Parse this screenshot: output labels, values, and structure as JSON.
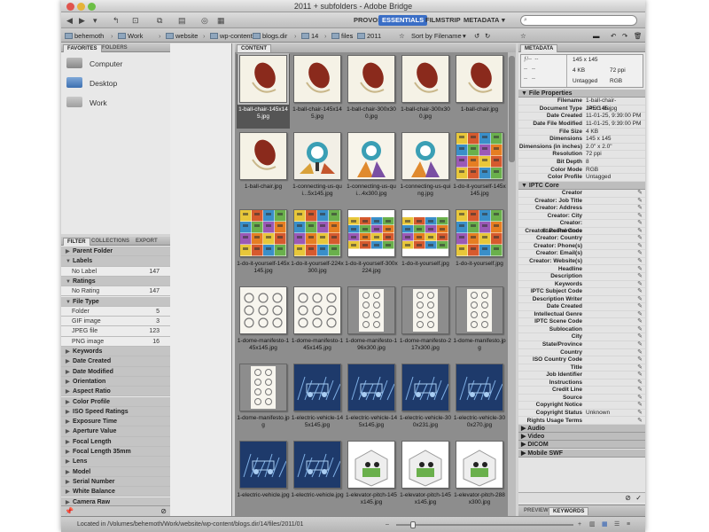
{
  "window": {
    "title": "2011 + subfolders - Adobe Bridge"
  },
  "workspaces": [
    {
      "label": "PROVOST",
      "active": false
    },
    {
      "label": "ESSENTIALS",
      "active": true
    },
    {
      "label": "FILMSTRIP",
      "active": false
    },
    {
      "label": "METADATA",
      "active": false
    }
  ],
  "search": {
    "placeholder": ""
  },
  "breadcrumbs": [
    "behemoth",
    "Work",
    "website",
    "wp-content",
    "blogs.dir",
    "14",
    "files",
    "2011"
  ],
  "sort": {
    "label": "Sort by Filename"
  },
  "left": {
    "top_tabs": [
      "FAVORITES",
      "FOLDERS"
    ],
    "favorites": [
      {
        "label": "Computer",
        "icon": "computer-icon"
      },
      {
        "label": "Desktop",
        "icon": "desktop-icon"
      },
      {
        "label": "Work",
        "icon": "folder-icon"
      }
    ],
    "bottom_tabs": [
      "FILTER",
      "COLLECTIONS",
      "EXPORT"
    ],
    "filters": [
      {
        "label": "Parent Folder",
        "type": "hdr"
      },
      {
        "label": "Labels",
        "type": "hdr",
        "open": true
      },
      {
        "label": "No Label",
        "type": "sub",
        "count": "147"
      },
      {
        "label": "Ratings",
        "type": "hdr",
        "open": true
      },
      {
        "label": "No Rating",
        "type": "sub",
        "count": "147"
      },
      {
        "label": "File Type",
        "type": "hdr",
        "open": true
      },
      {
        "label": "Folder",
        "type": "sub",
        "count": "5"
      },
      {
        "label": "GIF image",
        "type": "sub",
        "count": "3"
      },
      {
        "label": "JPEG file",
        "type": "sub",
        "count": "123"
      },
      {
        "label": "PNG image",
        "type": "sub",
        "count": "16"
      },
      {
        "label": "Keywords",
        "type": "hdr"
      },
      {
        "label": "Date Created",
        "type": "hdr"
      },
      {
        "label": "Date Modified",
        "type": "hdr"
      },
      {
        "label": "Orientation",
        "type": "hdr"
      },
      {
        "label": "Aspect Ratio",
        "type": "hdr"
      },
      {
        "label": "Color Profile",
        "type": "hdr"
      },
      {
        "label": "ISO Speed Ratings",
        "type": "hdr"
      },
      {
        "label": "Exposure Time",
        "type": "hdr"
      },
      {
        "label": "Aperture Value",
        "type": "hdr"
      },
      {
        "label": "Focal Length",
        "type": "hdr"
      },
      {
        "label": "Focal Length 35mm",
        "type": "hdr"
      },
      {
        "label": "Lens",
        "type": "hdr"
      },
      {
        "label": "Model",
        "type": "hdr"
      },
      {
        "label": "Serial Number",
        "type": "hdr"
      },
      {
        "label": "White Balance",
        "type": "hdr"
      },
      {
        "label": "Camera Raw",
        "type": "hdr"
      },
      {
        "label": "Copyright Notice",
        "type": "hdr"
      }
    ]
  },
  "content": {
    "tab": "CONTENT",
    "thumbs": [
      {
        "caption": "1-ball-chair-145x145.jpg",
        "kind": "chair",
        "selected": true
      },
      {
        "caption": "1-ball-chair-145x145.jpg",
        "kind": "chair"
      },
      {
        "caption": "1-ball-chair-300x300.jpg",
        "kind": "chair"
      },
      {
        "caption": "1-ball-chair-300x300.jpg",
        "kind": "chair"
      },
      {
        "caption": "1-ball-chair.jpg",
        "kind": "chair"
      },
      {
        "caption": "1-ball-chair.jpg",
        "kind": "chair"
      },
      {
        "caption": "1-connecting-us-qui...5x145.jpg",
        "kind": "connect"
      },
      {
        "caption": "1-connecting-us-qui...4x300.jpg",
        "kind": "connect2"
      },
      {
        "caption": "1-connecting-us-quing.jpg",
        "kind": "connect2"
      },
      {
        "caption": "1-do-it-yourself-145x145.jpg",
        "kind": "grid"
      },
      {
        "caption": "1-do-it-yourself-145x145.jpg",
        "kind": "grid"
      },
      {
        "caption": "1-do-it-yourself-224x300.jpg",
        "kind": "grid"
      },
      {
        "caption": "1-do-it-yourself-300x224.jpg",
        "kind": "gridwide"
      },
      {
        "caption": "1-do-it-yourself.jpg",
        "kind": "gridwide"
      },
      {
        "caption": "1-do-it-yourself.jpg",
        "kind": "grid"
      },
      {
        "caption": "1-dome-manifesto-145x145.jpg",
        "kind": "dome"
      },
      {
        "caption": "1-dome-manifesto-145x145.jpg",
        "kind": "dome"
      },
      {
        "caption": "1-dome-manifesto-196x300.jpg",
        "kind": "dometall"
      },
      {
        "caption": "1-dome-manifesto-217x300.jpg",
        "kind": "dometall"
      },
      {
        "caption": "1-dome-manifesto.jpg",
        "kind": "dometall"
      },
      {
        "caption": "1-dome-manifesto.jpg",
        "kind": "dometall"
      },
      {
        "caption": "1-electric-vehicle-145x145.jpg",
        "kind": "ev"
      },
      {
        "caption": "1-electric-vehicle-145x145.jpg",
        "kind": "ev"
      },
      {
        "caption": "1-electric-vehicle-300x231.jpg",
        "kind": "ev"
      },
      {
        "caption": "1-electric-vehicle-300x270.jpg",
        "kind": "ev"
      },
      {
        "caption": "1-electric-vehicle.jpg",
        "kind": "ev"
      },
      {
        "caption": "1-electric-vehicle.jpg",
        "kind": "ev"
      },
      {
        "caption": "1-elevator-pitch-145x145.jpg",
        "kind": "elev"
      },
      {
        "caption": "1-elevator-pitch-145x145.jpg",
        "kind": "elev"
      },
      {
        "caption": "1-elevator-pitch-288x300.jpg",
        "kind": "elev"
      }
    ]
  },
  "metadata": {
    "tab": "METADATA",
    "summary": {
      "dims": "145 x 145",
      "size": "4 KB",
      "ppi": "72 ppi",
      "tag": "Untagged",
      "mode": "RGB"
    },
    "file_props_title": "File Properties",
    "file_props": [
      {
        "k": "Filename",
        "v": "1-ball-chair-145x145.jpg"
      },
      {
        "k": "Document Type",
        "v": "JPEG file"
      },
      {
        "k": "Date Created",
        "v": "11-01-25, 9:39:00 PM"
      },
      {
        "k": "Date File Modified",
        "v": "11-01-25, 9:39:00 PM"
      },
      {
        "k": "File Size",
        "v": "4 KB"
      },
      {
        "k": "Dimensions",
        "v": "145 x 145"
      },
      {
        "k": "Dimensions (in inches)",
        "v": "2.0\" x 2.0\""
      },
      {
        "k": "Resolution",
        "v": "72 ppi"
      },
      {
        "k": "Bit Depth",
        "v": "8"
      },
      {
        "k": "Color Mode",
        "v": "RGB"
      },
      {
        "k": "Color Profile",
        "v": "Untagged"
      }
    ],
    "iptc_title": "IPTC Core",
    "iptc": [
      {
        "k": "Creator",
        "v": ""
      },
      {
        "k": "Creator: Job Title",
        "v": ""
      },
      {
        "k": "Creator: Address",
        "v": ""
      },
      {
        "k": "Creator: City",
        "v": ""
      },
      {
        "k": "Creator: State/Province",
        "v": ""
      },
      {
        "k": "Creator: Postal Code",
        "v": ""
      },
      {
        "k": "Creator: Country",
        "v": ""
      },
      {
        "k": "Creator: Phone(s)",
        "v": ""
      },
      {
        "k": "Creator: Email(s)",
        "v": ""
      },
      {
        "k": "Creator: Website(s)",
        "v": ""
      },
      {
        "k": "Headline",
        "v": ""
      },
      {
        "k": "Description",
        "v": ""
      },
      {
        "k": "Keywords",
        "v": ""
      },
      {
        "k": "IPTC Subject Code",
        "v": ""
      },
      {
        "k": "Description Writer",
        "v": ""
      },
      {
        "k": "Date Created",
        "v": ""
      },
      {
        "k": "Intellectual Genre",
        "v": ""
      },
      {
        "k": "IPTC Scene Code",
        "v": ""
      },
      {
        "k": "Sublocation",
        "v": ""
      },
      {
        "k": "City",
        "v": ""
      },
      {
        "k": "State/Province",
        "v": ""
      },
      {
        "k": "Country",
        "v": ""
      },
      {
        "k": "ISO Country Code",
        "v": ""
      },
      {
        "k": "Title",
        "v": ""
      },
      {
        "k": "Job Identifier",
        "v": ""
      },
      {
        "k": "Instructions",
        "v": ""
      },
      {
        "k": "Credit Line",
        "v": ""
      },
      {
        "k": "Source",
        "v": ""
      },
      {
        "k": "Copyright Notice",
        "v": ""
      },
      {
        "k": "Copyright Status",
        "v": "Unknown"
      },
      {
        "k": "Rights Usage Terms",
        "v": ""
      }
    ],
    "collapsed": [
      "Audio",
      "Video",
      "DICOM",
      "Mobile SWF"
    ],
    "bottom_tabs": [
      "PREVIEW",
      "KEYWORDS"
    ]
  },
  "status": {
    "text": "Located in /Volumes/behemoth/Work/website/wp-content/blogs.dir/14/files/2011/01"
  }
}
